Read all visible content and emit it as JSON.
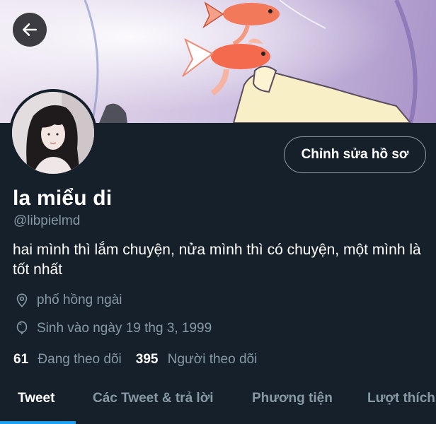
{
  "header": {
    "back_icon": "arrow-left-icon"
  },
  "profile": {
    "display_name": "la miểu di",
    "handle": "@libpielmd",
    "bio": "hai mình thì lắm chuyện, nửa mình thì có chuyện, một mình là tốt nhất",
    "location": "phố hồng ngài",
    "birthday": "Sinh vào ngày 19 thg 3, 1999",
    "edit_label": "Chỉnh sửa hồ sơ"
  },
  "stats": {
    "following_count": "61",
    "following_label": "Đang theo dõi",
    "followers_count": "395",
    "followers_label": "Người theo dõi"
  },
  "tabs": [
    {
      "label": "Tweet",
      "active": true
    },
    {
      "label": "Các Tweet & trả lời",
      "active": false
    },
    {
      "label": "Phương tiện",
      "active": false
    },
    {
      "label": "Lượt thích",
      "active": false
    }
  ],
  "colors": {
    "background": "#15202b",
    "secondary_text": "#8899a6",
    "accent": "#1da1f2"
  }
}
